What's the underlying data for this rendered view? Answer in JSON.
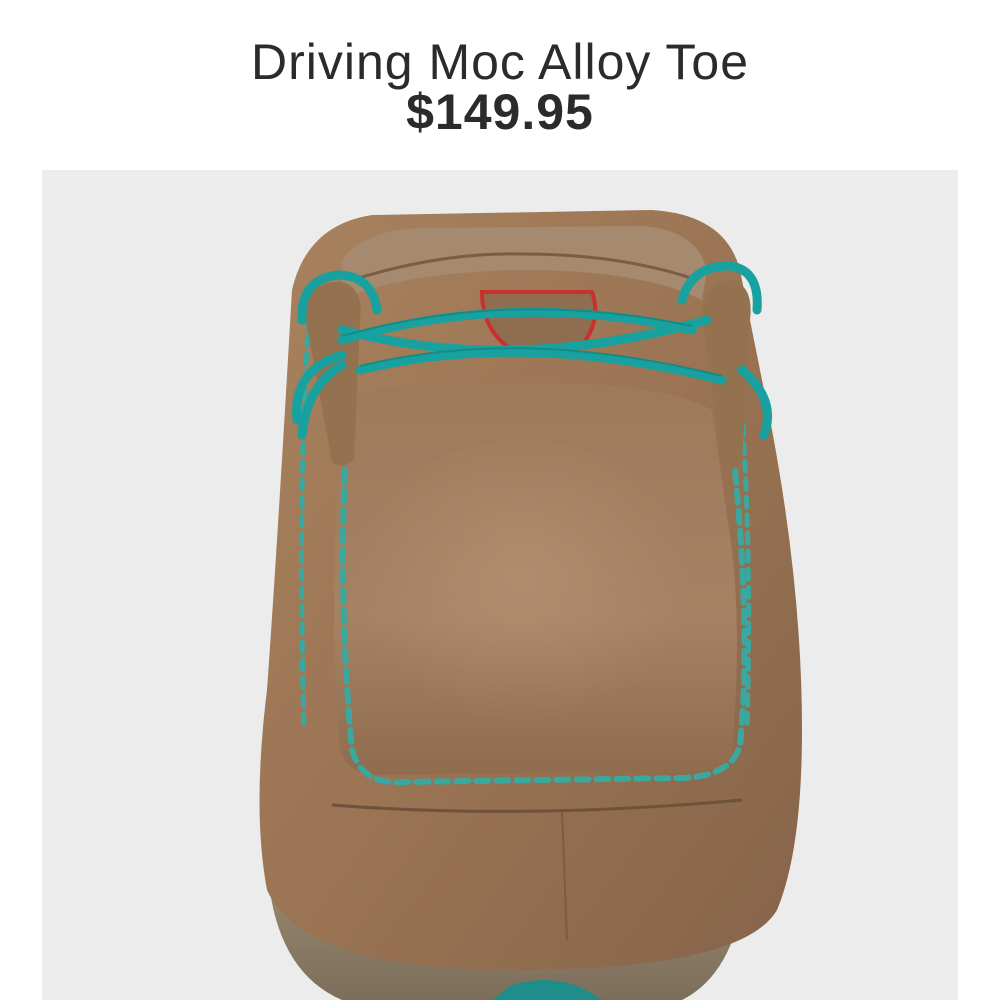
{
  "product": {
    "title": "Driving Moc Alloy Toe",
    "price": "$149.95",
    "image": {
      "alt": "Brown leather driving moc with turquoise laces and stitching, front view"
    }
  },
  "colors": {
    "background": "#ffffff",
    "image_bg": "#ececec",
    "text": "#2b2b2b",
    "leather": "#9a7655",
    "lace": "#1aa3a0",
    "logo": "#c8322e"
  }
}
